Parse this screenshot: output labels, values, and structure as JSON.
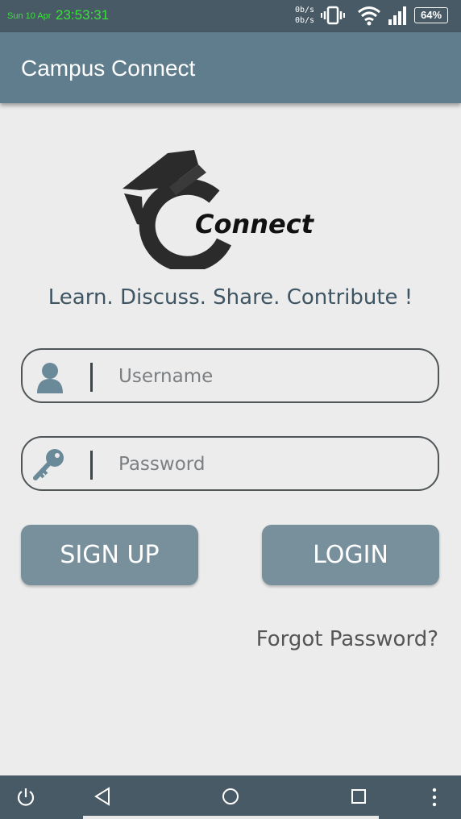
{
  "status_bar": {
    "date": "Sun 10 Apr",
    "time": "23:53:31",
    "net_up": "0b/s",
    "net_down": "0b/s",
    "battery": "64%",
    "icons": [
      "vibrate-icon",
      "wifi-icon",
      "signal-icon",
      "battery-icon"
    ]
  },
  "app_bar": {
    "title": "Campus Connect"
  },
  "logo": {
    "text": "Connect"
  },
  "tagline": "Learn. Discuss. Share. Contribute !",
  "username": {
    "placeholder": "Username",
    "value": "",
    "icon": "user-icon"
  },
  "password": {
    "placeholder": "Password",
    "value": "",
    "icon": "key-icon"
  },
  "buttons": {
    "signup": "SIGN UP",
    "login": "LOGIN"
  },
  "forgot_password": "Forgot Password?",
  "nav_bar": {
    "icons": [
      "power-icon",
      "back-icon",
      "home-icon",
      "recents-icon",
      "more-icon"
    ]
  },
  "colors": {
    "status_bar": "#485a65",
    "app_bar": "#5f7d8c",
    "button": "#78909b",
    "tagline": "#3e5563",
    "clock": "#38e23a",
    "background": "#ececec"
  }
}
